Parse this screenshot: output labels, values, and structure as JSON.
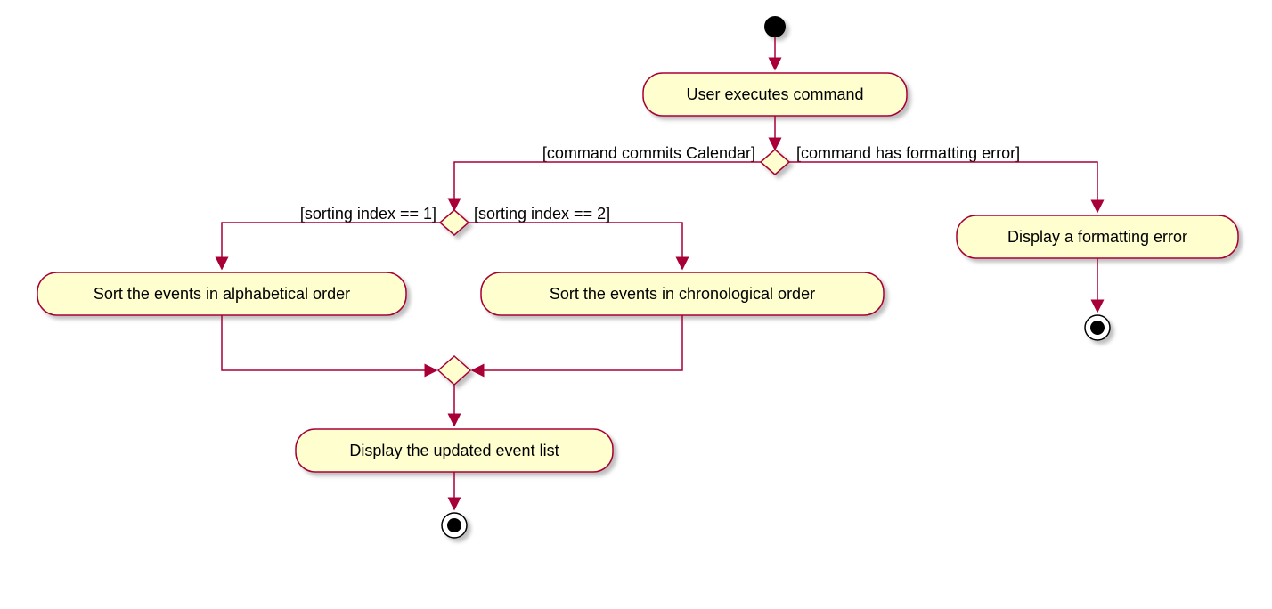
{
  "diagram": {
    "activity_start": "User executes command",
    "guard_left1": "[command commits Calendar]",
    "guard_right1": "[command has formatting error]",
    "guard_sort1": "[sorting index == 1]",
    "guard_sort2": "[sorting index == 2]",
    "activity_sort_alpha": "Sort the events in alphabetical order",
    "activity_sort_chrono": "Sort the events in chronological order",
    "activity_display_list": "Display the updated event list",
    "activity_display_error": "Display a formatting error"
  },
  "chart_data": {
    "type": "activity-diagram",
    "nodes": [
      {
        "id": "start",
        "kind": "initial"
      },
      {
        "id": "exec",
        "kind": "action",
        "label": "User executes command"
      },
      {
        "id": "d1",
        "kind": "decision",
        "guards": [
          "command commits Calendar",
          "command has formatting error"
        ]
      },
      {
        "id": "d2",
        "kind": "decision",
        "guards": [
          "sorting index == 1",
          "sorting index == 2"
        ]
      },
      {
        "id": "alpha",
        "kind": "action",
        "label": "Sort the events in alphabetical order"
      },
      {
        "id": "chrono",
        "kind": "action",
        "label": "Sort the events in chronological order"
      },
      {
        "id": "merge",
        "kind": "merge"
      },
      {
        "id": "display",
        "kind": "action",
        "label": "Display the updated event list"
      },
      {
        "id": "err",
        "kind": "action",
        "label": "Display a formatting error"
      },
      {
        "id": "end1",
        "kind": "final"
      },
      {
        "id": "end2",
        "kind": "final"
      }
    ],
    "edges": [
      [
        "start",
        "exec"
      ],
      [
        "exec",
        "d1"
      ],
      [
        "d1",
        "d2",
        "command commits Calendar"
      ],
      [
        "d1",
        "err",
        "command has formatting error"
      ],
      [
        "d2",
        "alpha",
        "sorting index == 1"
      ],
      [
        "d2",
        "chrono",
        "sorting index == 2"
      ],
      [
        "alpha",
        "merge"
      ],
      [
        "chrono",
        "merge"
      ],
      [
        "merge",
        "display"
      ],
      [
        "display",
        "end1"
      ],
      [
        "err",
        "end2"
      ]
    ]
  }
}
